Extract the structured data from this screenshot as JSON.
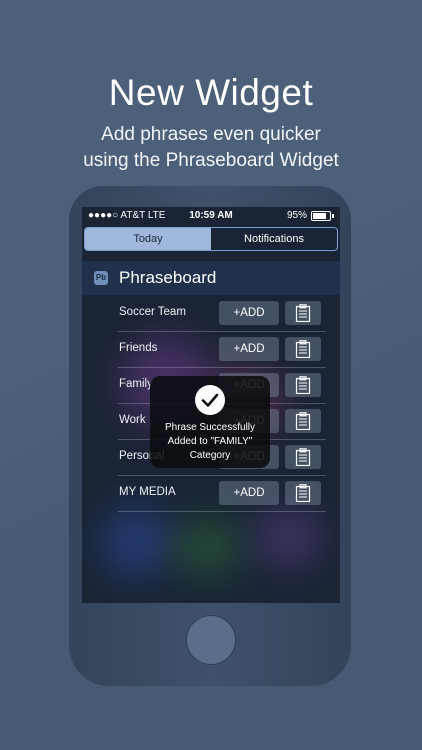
{
  "promo": {
    "title": "New Widget",
    "subtitle_line1": "Add phrases even quicker",
    "subtitle_line2": "using the Phraseboard Widget"
  },
  "status_bar": {
    "carrier": "●●●●○ AT&T  LTE",
    "time": "10:59 AM",
    "battery_percent": "95%",
    "battery_level": 0.95
  },
  "notification_center": {
    "tabs": [
      {
        "label": "Today",
        "selected": true
      },
      {
        "label": "Notifications",
        "selected": false
      }
    ]
  },
  "widget": {
    "app_icon_text": "Pb",
    "title": "Phraseboard",
    "add_label": "+ADD",
    "rows": [
      {
        "label": "Soccer Team"
      },
      {
        "label": "Friends"
      },
      {
        "label": "Family"
      },
      {
        "label": "Work"
      },
      {
        "label": "Personal"
      },
      {
        "label": "MY MEDIA"
      }
    ]
  },
  "toast": {
    "line1": "Phrase Successfully",
    "line2": "Added to \"FAMILY\"",
    "line3": "Category",
    "icon": "checkmark-icon"
  },
  "colors": {
    "background": "#4d6079",
    "tab_selected": "#9fb8dc",
    "tab_border": "#7c9fd1"
  }
}
